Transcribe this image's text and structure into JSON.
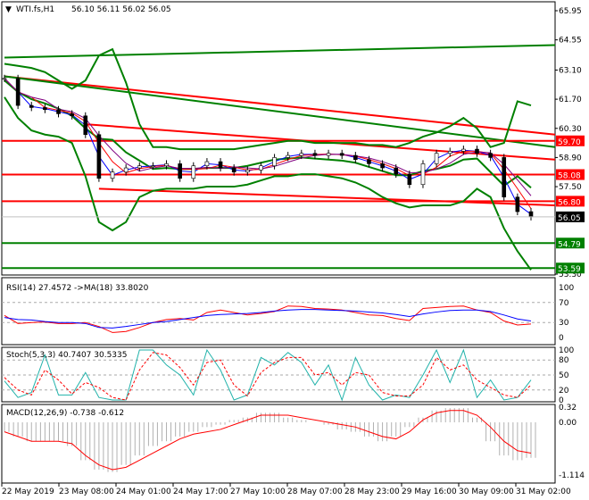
{
  "header": {
    "symbol": "WTI.fs,H1",
    "ohlc": "56.10 56.11 56.02 56.05"
  },
  "chart_data": [
    {
      "type": "line",
      "title": "WTI.fs,H1",
      "ylim": [
        53.3,
        65.95
      ],
      "price_ticks": [
        "65.95",
        "64.55",
        "63.10",
        "61.70",
        "60.30",
        "58.90",
        "57.50",
        "53.30"
      ],
      "close": [
        62.7,
        61.4,
        61.3,
        61.2,
        61.0,
        60.9,
        60.0,
        57.9,
        58.2,
        58.4,
        58.5,
        58.5,
        58.6,
        57.9,
        58.5,
        58.7,
        58.4,
        58.2,
        58.3,
        58.5,
        58.9,
        59.0,
        59.1,
        59.0,
        59.1,
        59.0,
        58.8,
        58.6,
        58.4,
        58.1,
        57.6,
        58.6,
        59.1,
        59.2,
        59.3,
        59.1,
        58.9,
        57.0,
        56.3,
        56.05
      ],
      "bb_upper": [
        63.4,
        63.3,
        63.2,
        63.0,
        62.6,
        62.2,
        62.6,
        63.8,
        64.1,
        62.5,
        60.5,
        59.4,
        59.4,
        59.3,
        59.3,
        59.3,
        59.3,
        59.3,
        59.4,
        59.5,
        59.6,
        59.7,
        59.7,
        59.6,
        59.6,
        59.6,
        59.6,
        59.5,
        59.5,
        59.4,
        59.6,
        59.9,
        60.1,
        60.4,
        60.8,
        60.3,
        59.4,
        59.6,
        61.6,
        61.4
      ],
      "bb_lower": [
        61.8,
        60.8,
        60.2,
        60.0,
        59.9,
        59.6,
        58.0,
        55.8,
        55.4,
        55.8,
        57.0,
        57.3,
        57.4,
        57.4,
        57.4,
        57.5,
        57.5,
        57.5,
        57.6,
        57.8,
        58.0,
        58.0,
        58.1,
        58.1,
        58.0,
        57.9,
        57.7,
        57.4,
        57.0,
        56.7,
        56.5,
        56.6,
        56.6,
        56.6,
        56.8,
        57.4,
        57.0,
        55.5,
        54.4,
        53.5
      ],
      "levels": [
        {
          "value": "59.70",
          "color": "#ff0000"
        },
        {
          "value": "58.08",
          "color": "#ff0000"
        },
        {
          "value": "56.80",
          "color": "#ff0000"
        },
        {
          "value": "54.79",
          "color": "#008000"
        },
        {
          "value": "53.59",
          "color": "#008000"
        }
      ],
      "current_price": "56.05",
      "trendlines": [
        {
          "from": [
            0,
            63.7
          ],
          "to": [
            39,
            64.3
          ],
          "color": "#008000"
        },
        {
          "from": [
            0,
            62.8
          ],
          "to": [
            39,
            60.0
          ],
          "color": "#ff0000"
        },
        {
          "from": [
            0,
            62.8
          ],
          "to": [
            39,
            59.4
          ],
          "color": "#008000"
        },
        {
          "from": [
            6,
            60.5
          ],
          "to": [
            39,
            58.8
          ],
          "color": "#ff0000"
        },
        {
          "from": [
            7,
            57.4
          ],
          "to": [
            39,
            56.6
          ],
          "color": "#ff0000"
        }
      ]
    },
    {
      "type": "line",
      "label": "RSI(14) 27.4572  ->MA(18) 33.8020",
      "ylim": [
        0,
        100
      ],
      "ticks": [
        "100",
        "70",
        "30",
        "0"
      ],
      "rsi": [
        44,
        28,
        30,
        31,
        28,
        28,
        30,
        22,
        10,
        12,
        20,
        30,
        36,
        38,
        35,
        50,
        55,
        50,
        45,
        48,
        52,
        63,
        62,
        58,
        57,
        55,
        50,
        45,
        44,
        38,
        34,
        58,
        60,
        62,
        63,
        55,
        50,
        33,
        25,
        27
      ],
      "ma": [
        40,
        36,
        35,
        32,
        30,
        30,
        28,
        20,
        19,
        22,
        26,
        30,
        32,
        36,
        40,
        44,
        46,
        47,
        48,
        50,
        53,
        55,
        56,
        56,
        55,
        54,
        53,
        51,
        49,
        46,
        42,
        47,
        51,
        54,
        55,
        55,
        52,
        45,
        37,
        33
      ]
    },
    {
      "type": "line",
      "label": "Stoch(5,3,3) 40.7407 30.5335",
      "ylim": [
        0,
        100
      ],
      "ticks": [
        "100",
        "80",
        "50",
        "20",
        "0"
      ],
      "main": [
        38,
        5,
        15,
        90,
        10,
        10,
        55,
        5,
        0,
        0,
        100,
        100,
        70,
        50,
        10,
        100,
        60,
        0,
        10,
        85,
        70,
        95,
        75,
        30,
        70,
        0,
        85,
        30,
        0,
        10,
        5,
        50,
        100,
        35,
        100,
        5,
        40,
        0,
        5,
        40
      ],
      "signal": [
        45,
        20,
        10,
        60,
        40,
        12,
        35,
        25,
        5,
        0,
        60,
        95,
        90,
        65,
        30,
        75,
        80,
        30,
        8,
        55,
        75,
        85,
        85,
        50,
        55,
        30,
        55,
        50,
        15,
        8,
        8,
        30,
        85,
        60,
        70,
        40,
        25,
        10,
        5,
        30
      ]
    },
    {
      "type": "bar",
      "label": "MACD(12,26,9) -0.738 -0.612",
      "ylim": [
        -1.114,
        0.32
      ],
      "ticks": [
        "0.32",
        "0.00",
        "-1.114"
      ],
      "histogram": [
        -0.2,
        -0.3,
        -0.4,
        -0.4,
        -0.4,
        -0.5,
        -0.8,
        -1.0,
        -1.05,
        -0.9,
        -0.7,
        -0.5,
        -0.4,
        -0.3,
        -0.2,
        -0.1,
        -0.05,
        0.05,
        0.1,
        0.2,
        0.2,
        0.1,
        0.05,
        0.0,
        -0.05,
        -0.15,
        -0.2,
        -0.3,
        -0.4,
        -0.3,
        -0.1,
        0.1,
        0.25,
        0.3,
        0.3,
        0.1,
        -0.4,
        -0.7,
        -0.8,
        -0.75
      ],
      "signal": [
        -0.2,
        -0.3,
        -0.4,
        -0.4,
        -0.4,
        -0.45,
        -0.7,
        -0.9,
        -1.0,
        -0.95,
        -0.8,
        -0.65,
        -0.5,
        -0.35,
        -0.25,
        -0.2,
        -0.15,
        -0.05,
        0.05,
        0.15,
        0.15,
        0.15,
        0.1,
        0.05,
        0.0,
        -0.05,
        -0.1,
        -0.2,
        -0.3,
        -0.35,
        -0.2,
        0.05,
        0.2,
        0.25,
        0.25,
        0.15,
        -0.1,
        -0.4,
        -0.6,
        -0.65
      ]
    }
  ],
  "x_labels": [
    "22 May 2019",
    "23 May 08:00",
    "24 May 01:00",
    "24 May 17:00",
    "27 May 10:00",
    "28 May 07:00",
    "28 May 23:00",
    "29 May 16:00",
    "30 May 09:00",
    "31 May 02:00"
  ]
}
